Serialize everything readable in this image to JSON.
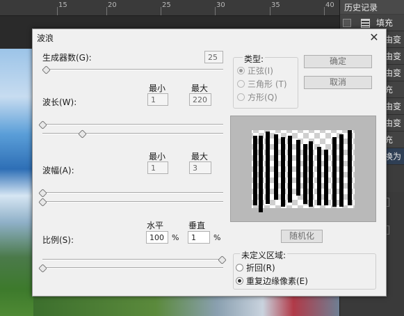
{
  "ruler": {
    "ticks": [
      "15",
      "20",
      "25",
      "30",
      "35",
      "40"
    ]
  },
  "history": {
    "tab_label": "历史记录",
    "rows": [
      "填充",
      "曲由变",
      "曲由变",
      "曲由变",
      "填充",
      "曲由变",
      "曲由变",
      "填充",
      "替换为"
    ]
  },
  "dialog": {
    "title": "波浪",
    "generators": {
      "label": "生成器数(G):",
      "value": "25"
    },
    "wavelength": {
      "label": "波长(W):",
      "min_label": "最小",
      "max_label": "最大",
      "min": "1",
      "max": "220"
    },
    "amplitude": {
      "label": "波幅(A):",
      "min_label": "最小",
      "max_label": "最大",
      "min": "1",
      "max": "3"
    },
    "scale": {
      "label": "比例(S):",
      "h_label": "水平",
      "v_label": "垂直",
      "h": "100",
      "v": "1",
      "unit": "%"
    },
    "type": {
      "legend": "类型:",
      "options": [
        "正弦(I)",
        "三角形 (T)",
        "方形(Q)"
      ],
      "selected": 0
    },
    "ok_label": "确定",
    "cancel_label": "取消",
    "randomize_label": "随机化",
    "undefined_area": {
      "legend": "未定义区域:",
      "options": [
        "折回(R)",
        "重复边缘像素(E)"
      ],
      "selected": 1
    },
    "sliders": {
      "generators": 0.02,
      "wave_min": 0.0,
      "wave_max": 0.22,
      "amp_min": 0.0,
      "amp_max": 0.0,
      "scale_h": 1.0,
      "scale_v": 0.0
    }
  },
  "colors": {
    "dialog_bg": "#f0f0f0",
    "panel_bg": "#3c3c3c",
    "button_disabled_text": "#6d6d6d"
  }
}
